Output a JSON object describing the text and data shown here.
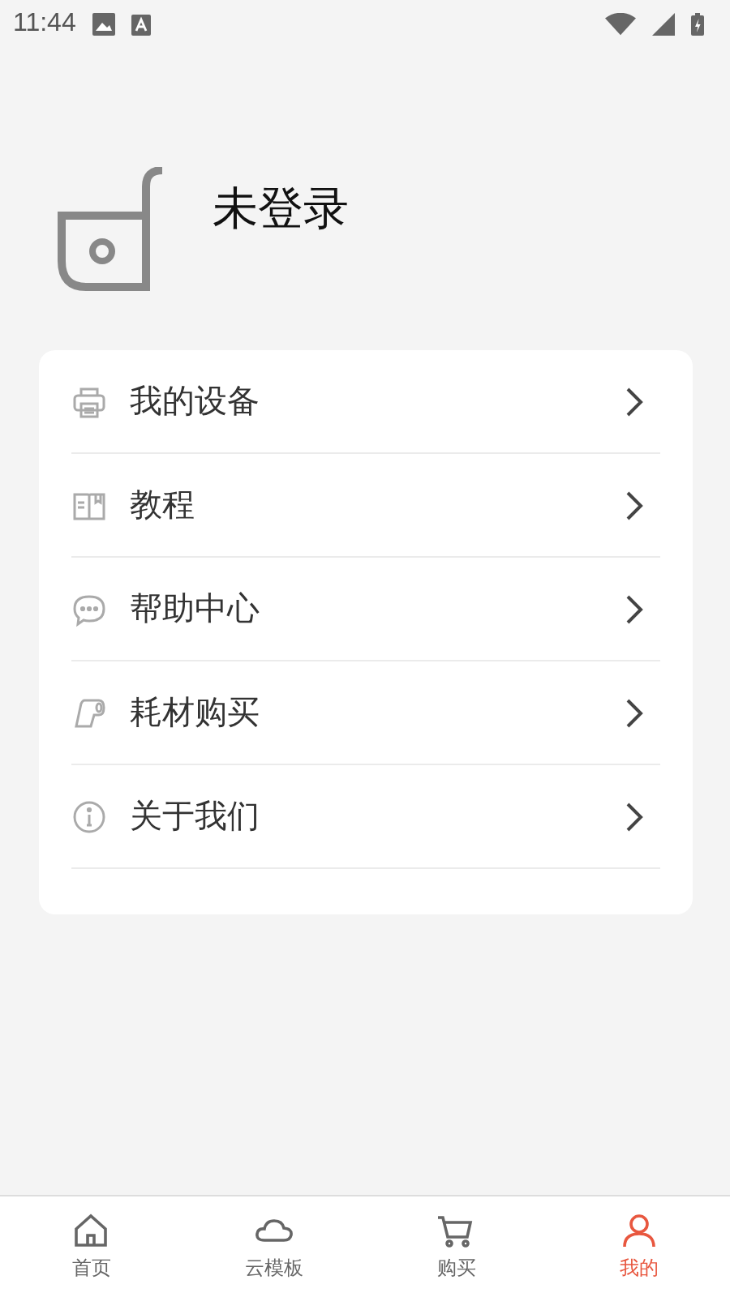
{
  "status_bar": {
    "time": "11:44"
  },
  "profile": {
    "name": "未登录"
  },
  "menu": [
    {
      "kind": "printer",
      "label": "我的设备"
    },
    {
      "kind": "book",
      "label": "教程"
    },
    {
      "kind": "chat",
      "label": "帮助中心"
    },
    {
      "kind": "roll",
      "label": "耗材购买"
    },
    {
      "kind": "info",
      "label": "关于我们"
    }
  ],
  "tabs": [
    {
      "kind": "home",
      "label": "首页",
      "selected": false
    },
    {
      "kind": "cloud",
      "label": "云模板",
      "selected": false
    },
    {
      "kind": "cart",
      "label": "购买",
      "selected": false
    },
    {
      "kind": "user",
      "label": "我的",
      "selected": true
    }
  ]
}
